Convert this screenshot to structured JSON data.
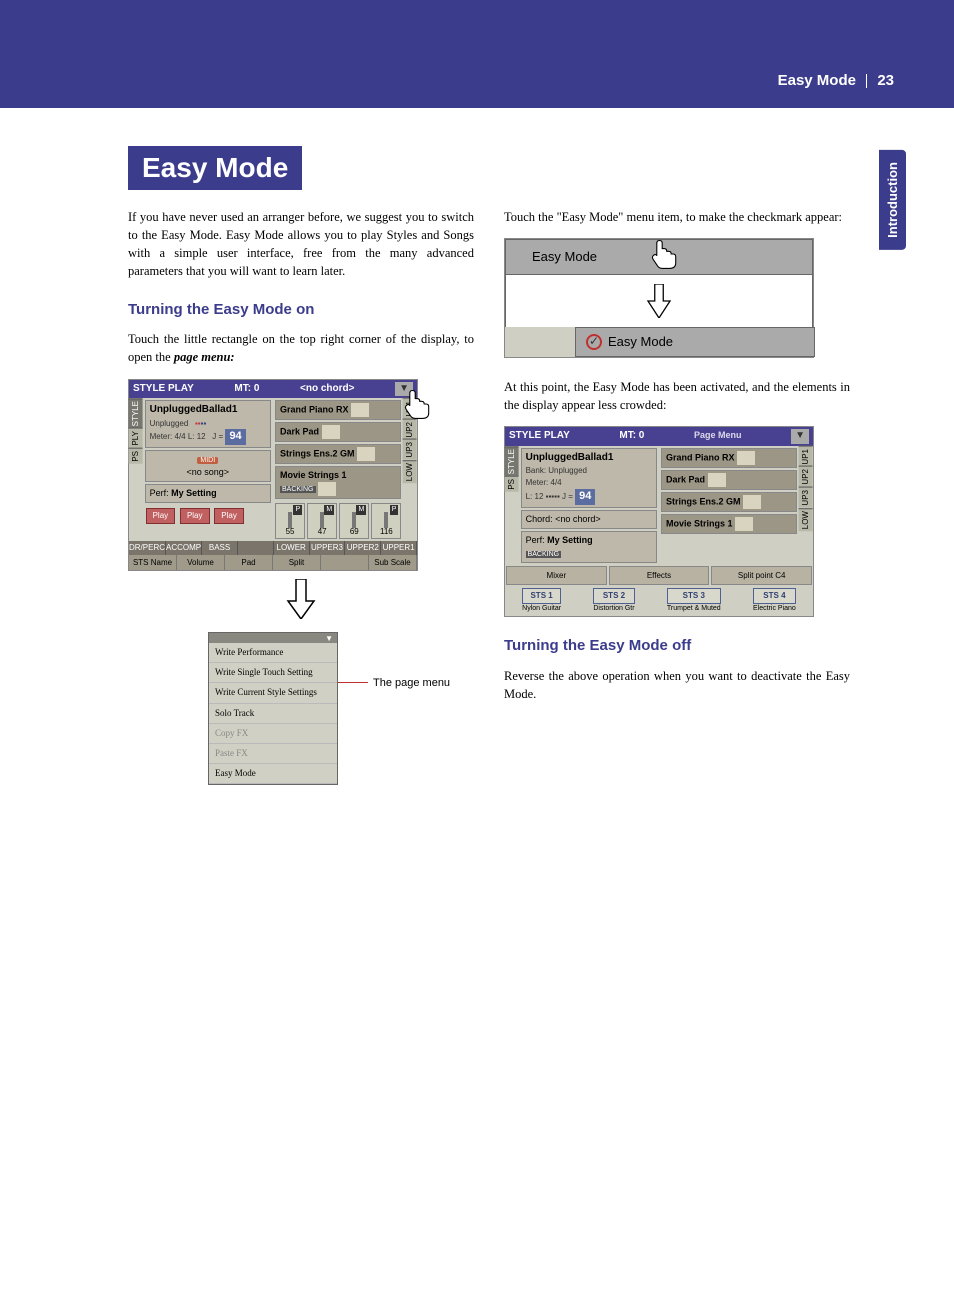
{
  "header": {
    "running_head": "Easy Mode",
    "page_number": "23",
    "side_tab": "Introduction"
  },
  "title": "Easy Mode",
  "col_left": {
    "intro": "If you have never used an arranger before, we suggest you to switch to the Easy Mode. Easy Mode allows you to play Styles and Songs with a simple user interface, free from the many advanced parameters that you will want to learn later.",
    "subhead1": "Turning the Easy Mode on",
    "p1a": "Touch the little rectangle on the top right corner of the display, to open the ",
    "p1b": "page menu:",
    "anno_page_menu": "The page menu"
  },
  "col_right": {
    "p1": "Touch the \"Easy Mode\" menu item, to make the checkmark appear:",
    "p2": "At this point, the Easy Mode has been activated, and the elements in the display appear less crowded:",
    "subhead2": "Turning the Easy Mode off",
    "p3": "Reverse the above operation when you want to deactivate the Easy Mode."
  },
  "lcd1": {
    "header_left": "STYLE PLAY",
    "header_mid": "MT: 0",
    "header_right": "<no chord>",
    "style_name": "UnpluggedBallad1",
    "bank_label": "Unplugged",
    "meter": "Meter: 4/4  L: 12",
    "tempo_prefix": "J =",
    "tempo": "94",
    "song_row": "<no song>",
    "song_badge": "MIDI",
    "perf_label": "Perf:",
    "perf_value": "My Setting",
    "rcell1": "Grand Piano RX",
    "rcell2": "Dark Pad",
    "rcell3": "Strings Ens.2 GM",
    "rcell4": "Movie Strings 1",
    "r_backing": "BACKING",
    "knob_vals": [
      "55",
      "47",
      "69",
      "116"
    ],
    "play_btns": [
      "Play",
      "Play",
      "Play"
    ],
    "btn_row": [
      "DR/PERC",
      "ACCOMP",
      "BASS",
      "",
      "LOWER",
      "UPPER3",
      "UPPER2",
      "UPPER1"
    ],
    "tab_row": [
      "STS Name",
      "Volume",
      "Pad",
      "Split",
      "",
      "Sub Scale",
      "",
      ""
    ],
    "vtabs_left": [
      "STYLE",
      "PLY",
      "PS"
    ],
    "vtabs_right": [
      "UP1",
      "UP2",
      "UP3",
      "LOW"
    ]
  },
  "dropdown": {
    "items": [
      "Write Performance",
      "Write Single Touch Setting",
      "Write Current Style Settings",
      "Solo Track",
      "Copy FX",
      "Paste FX",
      "Easy Mode"
    ],
    "disabled_idx": [
      4,
      5
    ]
  },
  "em_toggle": {
    "label": "Easy Mode"
  },
  "lcd2": {
    "header_left": "STYLE PLAY",
    "header_mid": "MT: 0",
    "header_right": "Page Menu",
    "style_name": "UnpluggedBallad1",
    "bank": "Bank: Unplugged",
    "meter": "Meter: 4/4",
    "tempo_line": "L: 12  ▪▪▪▪▪  J =",
    "tempo": "94",
    "chord": "Chord: <no chord>",
    "perf_label": "Perf:",
    "perf_value": "My Setting",
    "r_backing": "BACKING",
    "rcell1": "Grand Piano RX",
    "rcell2": "Dark Pad",
    "rcell3": "Strings Ens.2 GM",
    "rcell4": "Movie Strings 1",
    "bbtns": [
      "Mixer",
      "Effects",
      "Split point C4"
    ],
    "sts": [
      "STS 1",
      "STS 2",
      "STS 3",
      "STS 4"
    ],
    "sts_lbls": [
      "Nylon Guitar",
      "Distortion Gtr",
      "Trumpet & Muted",
      "Electric Piano"
    ],
    "vtabs_left": [
      "STYLE",
      "PS"
    ],
    "vtabs_right": [
      "UP1",
      "UP2",
      "UP3",
      "LOW"
    ]
  }
}
